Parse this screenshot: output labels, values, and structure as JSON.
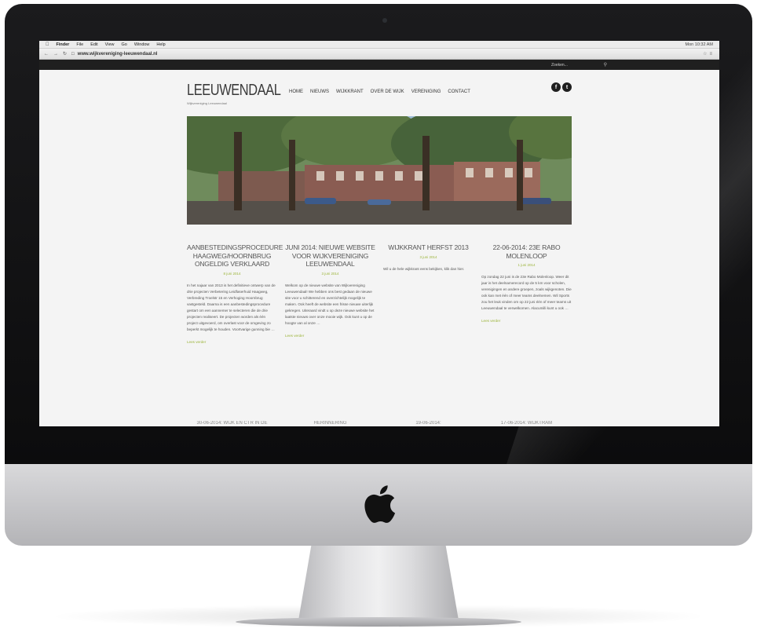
{
  "mac_menubar": {
    "apple": "",
    "app": "Finder",
    "menus": [
      "File",
      "Edit",
      "View",
      "Go",
      "Window",
      "Help"
    ],
    "right_status": "Mon 10:32 AM"
  },
  "browser": {
    "url": "www.wijkvereniging-leeuwendaal.nl"
  },
  "site": {
    "search_placeholder": "Zoeken...",
    "logo": "LEEUWENDAAL",
    "tagline": "Wijkvereniging Leeuwendaal",
    "nav": [
      "HOME",
      "NIEUWS",
      "WIJKKRANT",
      "OVER DE WIJK",
      "VERENIGING",
      "CONTACT"
    ],
    "social": {
      "facebook": "f",
      "twitter": "t"
    }
  },
  "posts": [
    {
      "title": "AANBESTEDINGSPROCEDURE HAAGWEG/HOORNBRUG ONGELDIG VERKLAARD",
      "date": "8 juni 2014",
      "body": "In het najaar van 2013 is het definitieve ontwerp van de drie projecten Verbetering Leidfaserhuid Haagweg, Verbreding Troelstr 15 en Verhoging Hoornbrug vastgesteld. Daarna is een aanbestedingsprocedure gestart om een aannemer te selecteren die de drie projecten realiseert. De projecten worden als één project uitgevoerd, om overlast voor de omgeving zo beperkt mogelijk te houden. Voortvarige gunning bie …",
      "more": "Lees verder"
    },
    {
      "title": "JUNI 2014: NIEUWE WEBSITE VOOR WIJKVERENIGING LEEUWENDAAL",
      "date": "3 juni 2014",
      "body": "Welkom op de nieuwe website van Wijkvereniging Leeuwendaal! We hebben ons best gedaan de nieuwe site voor u schitterend en overzichtelijk mogelijk te maken. Ook heeft de website een frisse nieuwe uiterlijk gekregen. Uiteraard vindt u op deze nieuwe website het laatste nieuws over onze mooie wijk. Ook kunt u op de hoogte van al onze …",
      "more": "Lees verder"
    },
    {
      "title": "WIJKKRANT HERFST 2013",
      "date": "3 juni 2014",
      "body": "Wil u de hele wijkkrant eens bekijken, klik dan hier.",
      "more": ""
    },
    {
      "title": "22-06-2014: 23E RABO MOLENLOOP",
      "date": "1 juni 2014",
      "body": "Op zondag 22 juni is de 23e Rabo Molenloop. Weer dit jaar is het deelnamerecord op de 5 km voor scholen, verenigingen en andere groepen, zoals wijkgenoten. Die ook kan met één of meer teams deelnemen. Wil Sports zou het leuk vinden om op 22 juni één of meer teams uit Leeuwendaal te verwelkomen. Alacumilli kunt u ook …",
      "more": "Lees verder"
    }
  ],
  "next_row_titles": [
    "30-06-2014: WIJK EN CTR IN DE",
    "HERINNERING",
    "19-06-2014:",
    "17-06-2014: WIJKTRAM"
  ]
}
